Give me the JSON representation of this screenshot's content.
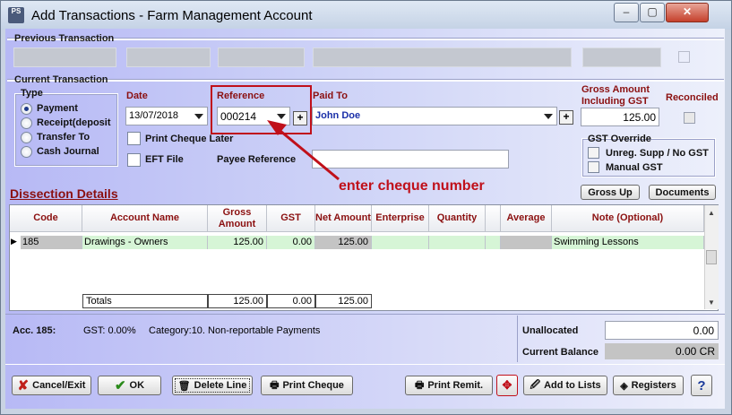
{
  "window": {
    "title": "Add Transactions - Farm Management Account",
    "icon_text": "PS",
    "buttons": {
      "minimize": "–",
      "maximize": "▢",
      "close": "✕"
    }
  },
  "previous_transaction": {
    "label": "Previous Transaction"
  },
  "current_transaction": {
    "label": "Current Transaction",
    "type": {
      "label": "Type",
      "options": [
        "Payment",
        "Receipt(deposit",
        "Transfer To",
        "Cash Journal"
      ],
      "selected": "Payment"
    },
    "date": {
      "label": "Date",
      "value": "13/07/2018"
    },
    "reference": {
      "label": "Reference",
      "value": "000214"
    },
    "paid_to": {
      "label": "Paid To",
      "value": "John Doe"
    },
    "gross_amount": {
      "label_line1": "Gross Amount",
      "label_line2": "Including GST",
      "value": "125.00"
    },
    "reconciled": {
      "label": "Reconciled",
      "checked": false
    },
    "print_cheque_later": {
      "label": "Print Cheque Later",
      "checked": false
    },
    "eft_file": {
      "label": "EFT File",
      "checked": false
    },
    "payee_reference": {
      "label": "Payee Reference",
      "value": ""
    },
    "gst_override": {
      "label": "GST Override",
      "unreg": "Unreg. Supp / No GST",
      "manual": "Manual GST"
    },
    "gross_up_button": "Gross Up",
    "documents_button": "Documents"
  },
  "annotation": {
    "text": "enter cheque number",
    "color": "#c0101a"
  },
  "dissection": {
    "label": "Dissection Details",
    "columns": [
      "Code",
      "Account Name",
      "Gross Amount",
      "GST",
      "Net Amount",
      "Enterprise",
      "Quantity",
      "",
      "Average",
      "Note (Optional)"
    ],
    "rows": [
      {
        "code": "185",
        "account": "Drawings - Owners",
        "gross": "125.00",
        "gst": "0.00",
        "net": "125.00",
        "enterprise": "",
        "quantity": "",
        "extra": "",
        "average": "",
        "note": "Swimming Lessons"
      }
    ],
    "totals": {
      "label": "Totals",
      "gross": "125.00",
      "gst": "0.00",
      "net": "125.00"
    },
    "row_marker": "▶"
  },
  "footer": {
    "account": "Acc. 185:",
    "gst": "GST: 0.00%",
    "category": "Category:10. Non-reportable Payments",
    "unallocated_label": "Unallocated",
    "unallocated_value": "0.00",
    "balance_label": "Current Balance",
    "balance_value": "0.00 CR"
  },
  "buttons": {
    "cancel": "Cancel/Exit",
    "ok": "OK",
    "delete_line": "Delete Line",
    "print_cheque": "Print Cheque",
    "print_remit": "Print Remit.",
    "add_to_lists": "Add to Lists",
    "registers": "Registers",
    "help": "?"
  },
  "colors": {
    "accent_red": "#8b1010",
    "paid_to_blue": "#1a2fa8",
    "row_green": "#d6f5d6"
  }
}
